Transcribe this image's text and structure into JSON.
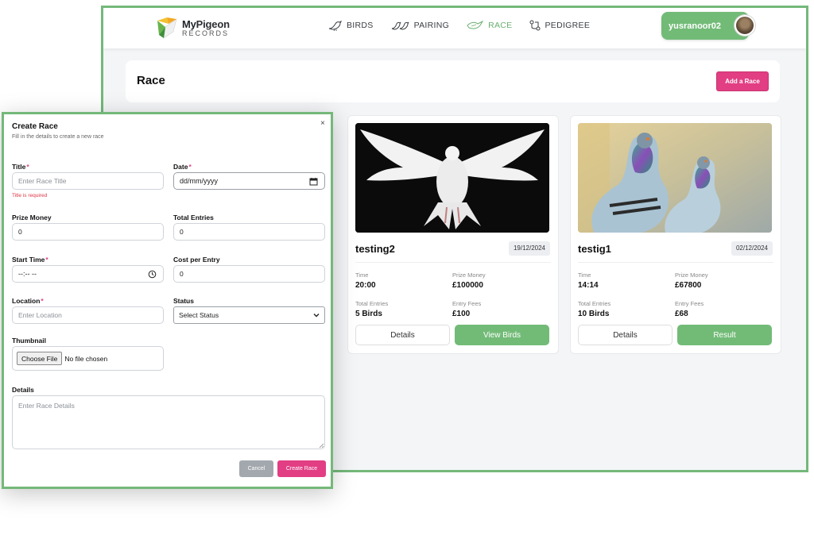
{
  "brand": {
    "name_part1": "My",
    "name_part2": "Pigeon",
    "sub": "RECORDS"
  },
  "nav": [
    {
      "label": "BIRDS",
      "icon": "bird-icon",
      "active": false
    },
    {
      "label": "PAIRING",
      "icon": "pair-birds-icon",
      "active": false
    },
    {
      "label": "RACE",
      "icon": "race-bird-icon",
      "active": true
    },
    {
      "label": "PEDIGREE",
      "icon": "pedigree-icon",
      "active": false
    }
  ],
  "user": {
    "name": "yusranoor02"
  },
  "page": {
    "title": "Race",
    "add_button": "Add a Race"
  },
  "cards": [
    {
      "name": "testing2",
      "date": "19/12/2024",
      "time_label": "Time",
      "time": "20:00",
      "prize_label": "Prize Money",
      "prize": "£100000",
      "entries_label": "Total Entries",
      "entries": "5 Birds",
      "fees_label": "Entry Fees",
      "fees": "£100",
      "details_button": "Details",
      "action_button": "View Birds"
    },
    {
      "name": "testig1",
      "date": "02/12/2024",
      "time_label": "Time",
      "time": "14:14",
      "prize_label": "Prize Money",
      "prize": "£67800",
      "entries_label": "Total Entries",
      "entries": "10 Birds",
      "fees_label": "Entry Fees",
      "fees": "£68",
      "details_button": "Details",
      "action_button": "Result"
    }
  ],
  "modal": {
    "title": "Create Race",
    "subtitle": "Fill in the details to create a new race",
    "close": "×",
    "fields": {
      "title": {
        "label": "Title",
        "required": "*",
        "placeholder": "Enter Race Title",
        "error": "Title is required"
      },
      "date": {
        "label": "Date",
        "required": "*",
        "value": "dd/mm/yyyy"
      },
      "prize": {
        "label": "Prize Money",
        "value": "0"
      },
      "entries": {
        "label": "Total Entries",
        "value": "0"
      },
      "start_time": {
        "label": "Start Time",
        "required": "*",
        "value": "--:-- --"
      },
      "cost": {
        "label": "Cost per Entry",
        "value": "0"
      },
      "location": {
        "label": "Location",
        "required": "*",
        "placeholder": "Enter Location"
      },
      "status": {
        "label": "Status",
        "value": "Select Status"
      },
      "thumbnail": {
        "label": "Thumbnail",
        "button": "Choose File",
        "status": "No file chosen"
      },
      "details": {
        "label": "Details",
        "placeholder": "Enter Race Details"
      }
    },
    "cancel": "Cancel",
    "submit": "Create Race"
  },
  "colors": {
    "accent_green": "#72bb77",
    "accent_pink": "#e23e84",
    "error": "#dc3545"
  }
}
